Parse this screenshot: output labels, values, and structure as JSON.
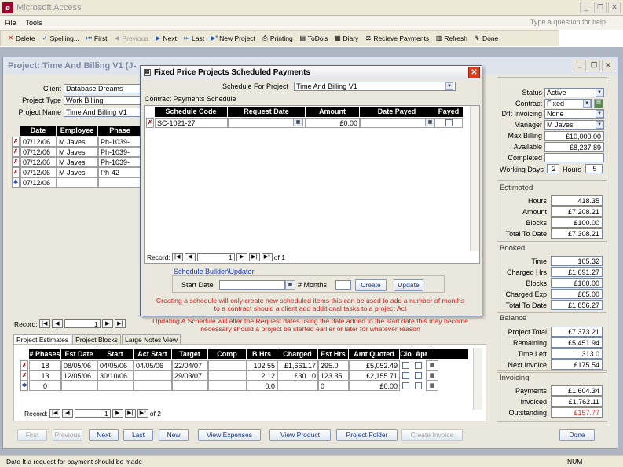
{
  "app": {
    "title": "Microsoft Access",
    "question_placeholder": "Type a question for help"
  },
  "menu": [
    "File",
    "Tools"
  ],
  "toolbar": [
    "Delete",
    "Spelling...",
    "First",
    "Previous",
    "Next",
    "Last",
    "New Project",
    "Printing",
    "ToDo's",
    "Diary",
    "Recieve Payments",
    "Refresh",
    "Done"
  ],
  "project": {
    "window_title": "Project: Time And Billing V1 (J-",
    "client_label": "Client",
    "client": "Database Dreams",
    "type_label": "Project Type",
    "type": "Work Billing",
    "name_label": "Project Name",
    "name": "Time And Billing V1",
    "grid_headers": [
      "Date",
      "Employee",
      "Phase"
    ],
    "grid_rows": [
      [
        "07/12/06",
        "M Javes",
        "Ph-1039-"
      ],
      [
        "07/12/06",
        "M Javes",
        "Ph-1039-"
      ],
      [
        "07/12/06",
        "M Javes",
        "Ph-1039-"
      ],
      [
        "07/12/06",
        "M Javes",
        "Ph-42"
      ],
      [
        "07/12/06",
        "",
        ""
      ]
    ],
    "record_label": "Record:",
    "record_num": "1"
  },
  "status_panel": {
    "status_label": "Status",
    "status": "Active",
    "contract_label": "Contract",
    "contract": "Fixed",
    "dflt_label": "Dflt Invoicing",
    "dflt": "None",
    "manager_label": "Manager",
    "manager": "M Javes",
    "maxbilling_label": "Max Billing",
    "maxbilling": "£10,000.00",
    "available_label": "Available",
    "available": "£8,237.89",
    "completed_label": "Completed",
    "workingdays_label": "Working Days",
    "workingdays": "2",
    "hours_label": "Hours",
    "hours": "5"
  },
  "estimated": {
    "title": "Estimated",
    "rows": [
      [
        "Hours",
        "418.35"
      ],
      [
        "Amount",
        "£7,208.21"
      ],
      [
        "Blocks",
        "£100.00"
      ],
      [
        "Total To Date",
        "£7,308.21"
      ]
    ]
  },
  "booked": {
    "title": "Booked",
    "rows": [
      [
        "Time",
        "105.32"
      ],
      [
        "Charged Hrs",
        "£1,691.27"
      ],
      [
        "Blocks",
        "£100.00"
      ],
      [
        "Charged Exp",
        "£65.00"
      ],
      [
        "Total To Date",
        "£1,856.27"
      ]
    ]
  },
  "balance": {
    "title": "Balance",
    "rows": [
      [
        "Project Total",
        "£7,373.21"
      ],
      [
        "Remaining",
        "£5,451.94"
      ],
      [
        "Time Left",
        "313.0"
      ],
      [
        "Next Invoice",
        "£175.54"
      ]
    ]
  },
  "invoicing": {
    "title": "Invoicing",
    "rows": [
      [
        "Payments",
        "£1,604.34"
      ],
      [
        "Invoiced",
        "£1,762.11"
      ],
      [
        "Outstanding",
        "£157.77"
      ]
    ],
    "outstanding_color": "#e02020"
  },
  "tabs": [
    "Project Estimates",
    "Project Blocks",
    "Large Notes View"
  ],
  "estimates": {
    "headers": [
      "# Phases",
      "Est Date",
      "Start",
      "Act Start",
      "Target",
      "Comp",
      "B Hrs",
      "Charged",
      "Est Hrs",
      "Amt Quoted",
      "Clo",
      "Apr"
    ],
    "rows": [
      [
        "18",
        "08/05/06",
        "04/05/06",
        "04/05/06",
        "22/04/07",
        "",
        "102.55",
        "£1,661.17",
        "295.0",
        "£5,052.49"
      ],
      [
        "13",
        "12/05/06",
        "30/10/06",
        "",
        "29/03/07",
        "",
        "2.12",
        "£30.10",
        "123.35",
        "£2,155.71"
      ],
      [
        "0",
        "",
        "",
        "",
        "",
        "",
        "0.0",
        "",
        "0",
        "£0.00"
      ]
    ],
    "record_num": "1",
    "record_of": "of  2"
  },
  "bottom_buttons": [
    "First",
    "Previous",
    "Next",
    "Last",
    "New",
    "View Expenses",
    "View Product",
    "Project Folder",
    "Create Invoice",
    "Done"
  ],
  "popup": {
    "title": "Fixed Price Projects Scheduled Payments",
    "sched_label": "Schedule For Project",
    "sched_value": "Time And Billing V1",
    "section_label": "Contract Payments Schedule",
    "headers": [
      "Schedule Code",
      "Request Date",
      "Amount",
      "Date Payed",
      "Payed"
    ],
    "row": [
      "SC-1021-27",
      "",
      "£0.00",
      ""
    ],
    "record_num": "1",
    "record_of": "of  1",
    "builder_label": "Schedule Builder\\Updater",
    "start_label": "Start Date",
    "months_label": "# Months",
    "create": "Create",
    "update": "Update",
    "note1": "Creating a schedule will only create new scheduled items this can be used to add a number of months to a contract should a client add additional tasks to a project Act",
    "note2": "Updating A Schedule will alter the Request dates using the date added to the start date this may become necessary should a project be started earlier or later for whatever reason"
  },
  "statusbar": {
    "left": "Date It a request for payment should be made",
    "right": "NUM"
  }
}
